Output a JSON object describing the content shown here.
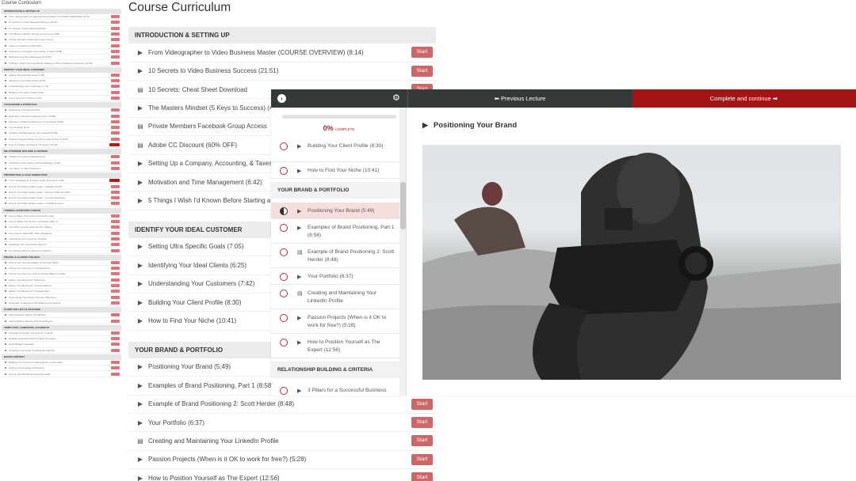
{
  "mini": {
    "title": "Course Curriculum",
    "sections": [
      {
        "title": "INTRODUCTION & SETTING UP",
        "items": [
          "From Videographer to Video Business Master (COURSE OVERVIEW) (8:14)",
          "10 Secrets to Video Business Success (21:51)",
          "10 Secrets: Cheat Sheet Download",
          "The Masters Mindset (5 Keys to Success) (4:59)",
          "Private Members Facebook Group Access",
          "Adobe CC Discount (60% OFF)",
          "Setting Up a Company, Accounting, & Taxes (8:08)",
          "Motivation and Time Management (6:42)",
          "5 Things I Wish I'd Known Before Starting a Video Production Company (10:28)"
        ]
      },
      {
        "title": "IDENTIFY YOUR IDEAL CUSTOMER",
        "items": [
          "Setting Ultra Specific Goals (7:05)",
          "Identifying Your Ideal Clients (6:25)",
          "Understanding Your Customers (7:42)",
          "Building Your Client Profile (8:30)",
          "How to Find Your Niche (10:41)"
        ]
      },
      {
        "title": "YOUR BRAND & PORTFOLIO",
        "items": [
          "Positioning Your Brand (5:49)",
          "Examples of Brand Positioning, Part 1 (8:58)",
          "Example of Brand Positioning 2: Scott Herder (8:48)",
          "Your Portfolio (6:37)",
          "Creating and Maintaining Your LinkedIn Profile",
          "Passion Projects (When is it OK to work for free?) (5:28)",
          "How to Position Yourself as The Expert (12:56)"
        ]
      },
      {
        "title": "RELATIONSHIP BUILDING & CRITERIA",
        "items": [
          "3 Pillars for a Successful Business",
          "3 Must-Do Cold Calling & Email Strategies (6:59)",
          "The Value of Video Production"
        ]
      },
      {
        "title": "PROSPECTING & LEAD GENERATION",
        "items": [
          "4 Key Strategies for Finding Leads (Overview) (4:30)",
          "How To Find High Quality Leads - LinkedIn (14:44)",
          "How To Find High Quality Leads - Getting a Referral (9:20)",
          "How To Find High Quality Leads - Account Specialists",
          "How To Find High Quality Leads - Local Businesses"
        ]
      },
      {
        "title": "TURNING LEADS INTO CLIENTS",
        "items": [
          "How to Make The Perfect Introduction Call",
          "How To Make The Perfect Introduction (Part 2)",
          "The Pitch: Let Your Work Do The Talking",
          "Get Content Ideas With Video Messages",
          "Automating Your Lead Gen Process",
          "Qualifying Your Lead (Client Buy-In)",
          "Not Sticking With the Recommendations"
        ]
      },
      {
        "title": "PRICING & CLOSING THE DEAL",
        "items": [
          "Pricing Your Services (Make Up Results) (8:50)",
          "Pricing Your Services: 5 Considerations",
          "Pricing Your Services: How to Charge Based on Value",
          "Master The Meeting Pt. Objectives",
          "Master The Meeting Pt. Counter Method",
          "Master The Meeting Pt. Proposal Q&A",
          "Overcoming The 5 Most Common Objections",
          "Proposals: Understand The Different Approaches"
        ]
      },
      {
        "title": "CLIENT ROLLOUT & COACHING",
        "items": [
          "Client Rollouts: Master the Meeting",
          "Client Rollouts: Meeting with Final Buyers"
        ]
      },
      {
        "title": "TEMPLATES, CAMPAIGNS, & BUDGETS",
        "items": [
          "Template Proposals, Documents, & Decks",
          "Replace Contracts With Pre-Filled Templates",
          "Email Budget Calculator",
          "Creating a Campaign Proposal and Planner"
        ]
      },
      {
        "title": "BONUS CONTENT",
        "items": [
          "Bridging The Gap From Videographer to Filmmaker",
          "Getting Your Prestige & Showreel",
          "How To Land Brand Sponsorship Deals"
        ]
      }
    ]
  },
  "main": {
    "title": "Course Curriculum",
    "start_label": "Start",
    "sections": [
      {
        "title": "INTRODUCTION & SETTING UP",
        "items": [
          {
            "icon": "play-icon",
            "label": "From Videographer to Video Business Master (COURSE OVERVIEW) (8:14)"
          },
          {
            "icon": "play-icon",
            "label": "10 Secrets to Video Business Success (21:51)"
          },
          {
            "icon": "document-icon",
            "label": "10 Secrets: Cheat Sheet Download"
          },
          {
            "icon": "play-icon",
            "label": "The Masters Mindset (5 Keys to Success) (4:59)"
          },
          {
            "icon": "document-icon",
            "label": "Private Members Facebook Group Access"
          },
          {
            "icon": "document-icon",
            "label": "Adobe CC Discount (60% OFF)"
          },
          {
            "icon": "play-icon",
            "label": "Setting Up a Company, Accounting, & Taxes (8:08)"
          },
          {
            "icon": "play-icon",
            "label": "Motivation and Time Management (6:42)"
          },
          {
            "icon": "play-icon",
            "label": "5 Things I Wish I'd Known Before Starting a Video Production Company (10:28)"
          }
        ]
      },
      {
        "title": "IDENTIFY YOUR IDEAL CUSTOMER",
        "items": [
          {
            "icon": "play-icon",
            "label": "Setting Ultra Specific Goals (7:05)"
          },
          {
            "icon": "play-icon",
            "label": "Identifying Your Ideal Clients (6:25)"
          },
          {
            "icon": "play-icon",
            "label": "Understanding Your Customers (7:42)"
          },
          {
            "icon": "play-icon",
            "label": "Building Your Client Profile (8:30)"
          },
          {
            "icon": "play-icon",
            "label": "How to Find Your Niche (10:41)"
          }
        ]
      },
      {
        "title": "YOUR BRAND & PORTFOLIO",
        "items": [
          {
            "icon": "play-icon",
            "label": "Positioning Your Brand (5:49)"
          },
          {
            "icon": "play-icon",
            "label": "Examples of Brand Positioning, Part 1 (8:58)"
          },
          {
            "icon": "play-icon",
            "label": "Example of Brand Positioning 2: Scott Herder (8:48)"
          },
          {
            "icon": "play-icon",
            "label": "Your Portfolio (6:37)"
          },
          {
            "icon": "document-icon",
            "label": "Creating and Maintaining Your LinkedIn Profile"
          },
          {
            "icon": "play-icon",
            "label": "Passion Projects (When is it OK to work for free?) (5:28)"
          },
          {
            "icon": "play-icon",
            "label": "How to Position Yourself as The Expert (12:56)"
          }
        ]
      }
    ]
  },
  "player": {
    "prev_label": "Previous Lecture",
    "complete_label": "Complete and continue",
    "progress_pct": "0%",
    "progress_word": "COMPLETE",
    "progress_fraction": 0.0,
    "lecture_title": "Positioning Your Brand",
    "sidebar": [
      {
        "type": "item",
        "icon": "play-icon",
        "label": "Building Your Client Profile (8:30)"
      },
      {
        "type": "item",
        "icon": "play-icon",
        "label": "How to Find Your Niche (10:41)"
      },
      {
        "type": "section",
        "label": "YOUR BRAND & PORTFOLIO"
      },
      {
        "type": "item",
        "icon": "play-icon",
        "label": "Positioning Your Brand (5:49)",
        "active": true
      },
      {
        "type": "item",
        "icon": "play-icon",
        "label": "Examples of Brand Positioning, Part 1 (8:58)"
      },
      {
        "type": "item",
        "icon": "document-icon",
        "label": "Example of Brand Positioning 2: Scott Herder (8:48)"
      },
      {
        "type": "item",
        "icon": "play-icon",
        "label": "Your Portfolio (6:37)"
      },
      {
        "type": "item",
        "icon": "document-icon",
        "label": "Creating and Maintaining Your LinkedIn Profile"
      },
      {
        "type": "item",
        "icon": "play-icon",
        "label": "Passion Projects (When is it OK to work for free?) (5:28)"
      },
      {
        "type": "item",
        "icon": "play-icon",
        "label": "How to Position Yourself as The Expert (12:56)"
      },
      {
        "type": "section",
        "label": "RELATIONSHIP BUILDING & CRITERIA"
      },
      {
        "type": "item",
        "icon": "play-icon",
        "label": "3 Pillars for a Successful Business"
      }
    ]
  },
  "colors": {
    "accent": "#a31414",
    "start_button": "#d06566",
    "topbar": "#34393a"
  }
}
